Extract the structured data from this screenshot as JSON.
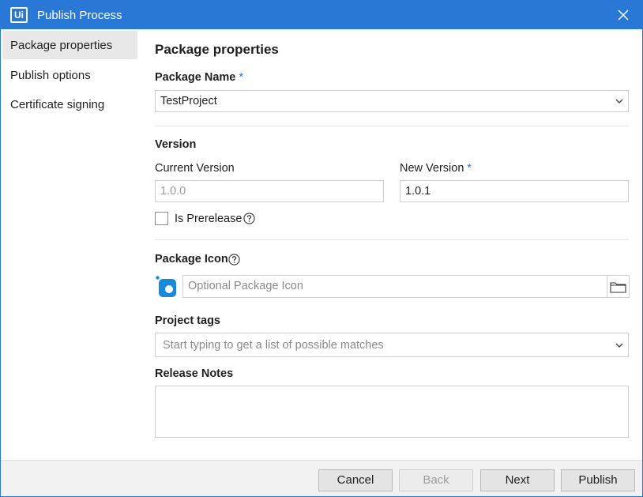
{
  "window": {
    "title": "Publish Process",
    "logo_text": "Ui"
  },
  "sidebar": {
    "items": [
      {
        "label": "Package properties",
        "active": true
      },
      {
        "label": "Publish options",
        "active": false
      },
      {
        "label": "Certificate signing",
        "active": false
      }
    ]
  },
  "main": {
    "heading": "Package properties",
    "package_name": {
      "label": "Package Name",
      "required_mark": "*",
      "value": "TestProject"
    },
    "version": {
      "section_label": "Version",
      "current_label": "Current Version",
      "current_value": "1.0.0",
      "new_label": "New Version",
      "new_required_mark": "*",
      "new_value": "1.0.1",
      "prerelease_label": "Is Prerelease",
      "prerelease_checked": false
    },
    "package_icon": {
      "label": "Package Icon",
      "placeholder": "Optional Package Icon"
    },
    "project_tags": {
      "label": "Project tags",
      "placeholder": "Start typing to get a list of possible matches"
    },
    "release_notes": {
      "label": "Release Notes",
      "value": ""
    }
  },
  "footer": {
    "cancel_label": "Cancel",
    "back_label": "Back",
    "next_label": "Next",
    "publish_label": "Publish"
  },
  "colors": {
    "accent": "#2a78d6",
    "icon_blue": "#1a8ad8"
  }
}
